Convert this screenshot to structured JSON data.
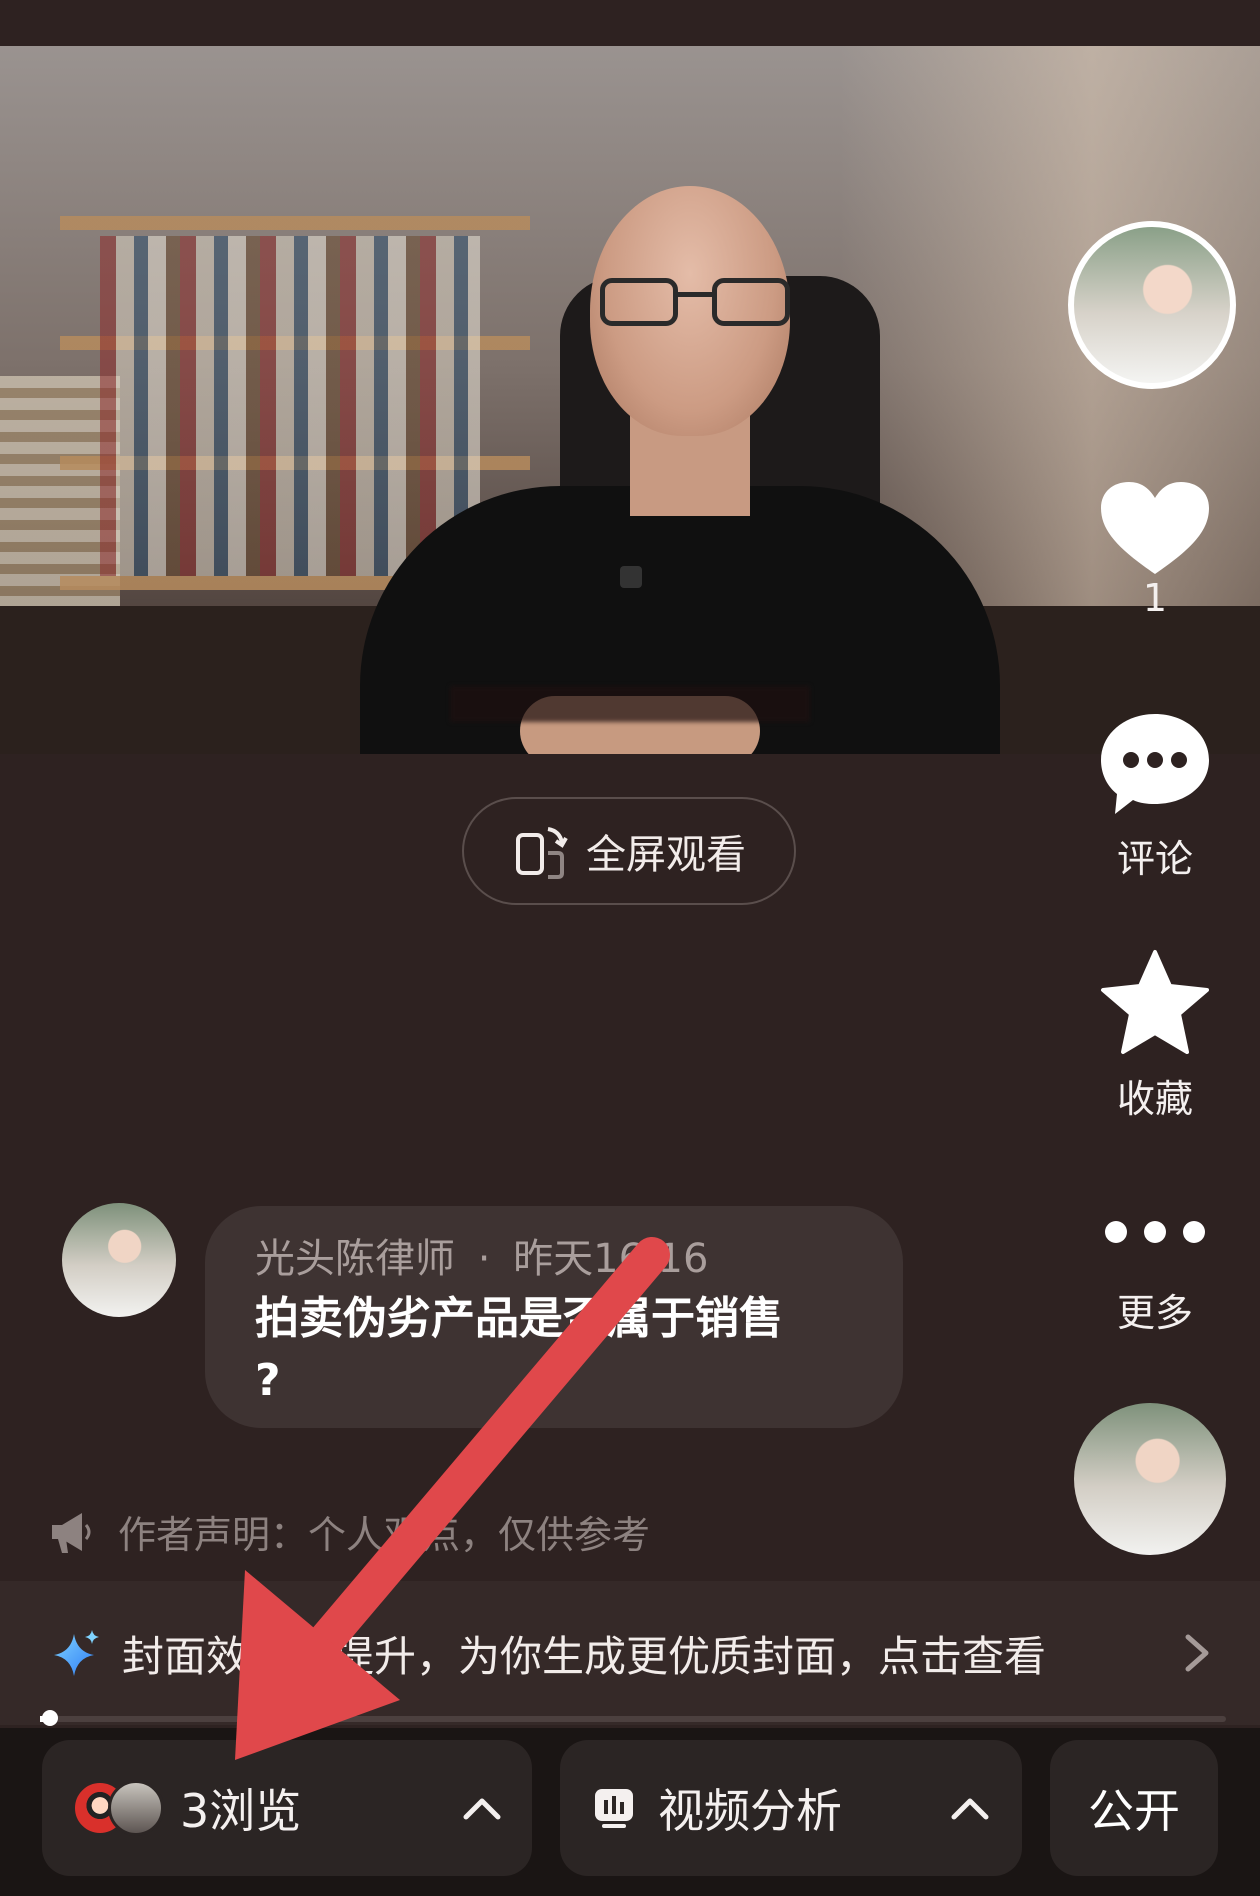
{
  "video": {
    "fullscreen_label": "全屏观看"
  },
  "side_actions": {
    "like_count": "1",
    "comment_label": "评论",
    "favorite_label": "收藏",
    "more_label": "更多"
  },
  "post": {
    "author": "光头陈律师",
    "separator": "·",
    "time": "昨天16:16",
    "text_line1": "拍卖伪劣产品是否属于销售",
    "text_line2": "?"
  },
  "statement": "作者声明：个人观点，仅供参考",
  "cover_tip": "封面效果可提升，为你生成更优质封面，点击查看",
  "bottom_bar": {
    "views_label": "3浏览",
    "analysis_label": "视频分析",
    "public_label": "公开"
  },
  "progress": {
    "played_fraction": 0.006
  },
  "colors": {
    "background": "#2e2221",
    "annotation_arrow": "#e0484b",
    "sparkle_blue": "#4aa8ff"
  },
  "icons": {
    "fullscreen": "rotate-phone-icon",
    "like": "heart-icon",
    "comment": "chat-bubble-icon",
    "favorite": "star-icon",
    "more": "more-dots-icon",
    "statement": "megaphone-icon",
    "cover": "sparkle-icon",
    "chevron": "chevron-right-icon",
    "views_toggle": "chevron-up-icon",
    "analysis": "bar-chart-icon"
  }
}
